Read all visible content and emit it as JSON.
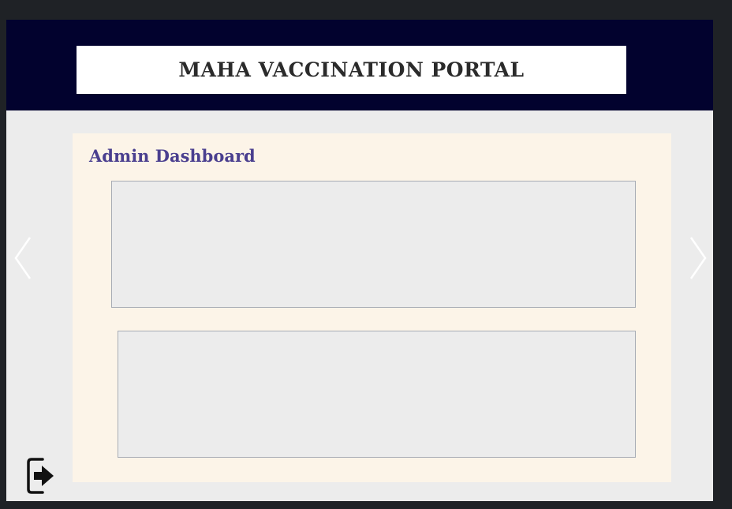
{
  "header": {
    "title": "MAHA VACCINATION PORTAL"
  },
  "dashboard": {
    "heading": "Admin Dashboard"
  },
  "icons": {
    "prev": "chevron-left-icon",
    "next": "chevron-right-icon",
    "logout": "sign-out-icon"
  },
  "colors": {
    "page_background": "#1f2226",
    "header_background": "#02022e",
    "content_background": "#ececec",
    "panel_background": "#fcf4e8",
    "heading_color": "#4a3f8f",
    "title_color": "#2b2b2b"
  }
}
